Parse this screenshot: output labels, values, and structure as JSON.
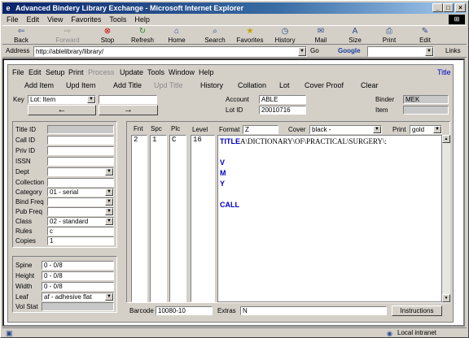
{
  "window": {
    "title": "Advanced Bindery Library Exchange - Microsoft Internet Explorer"
  },
  "ie_menu": [
    "File",
    "Edit",
    "View",
    "Favorites",
    "Tools",
    "Help"
  ],
  "toolbar": {
    "back": "Back",
    "forward": "Forward",
    "stop": "Stop",
    "refresh": "Refresh",
    "home": "Home",
    "search": "Search",
    "favorites": "Favorites",
    "history": "History",
    "mail": "Mail",
    "size": "Size",
    "print": "Print",
    "edit": "Edit"
  },
  "address": {
    "label": "Address",
    "url": "http://ablelibrary/library/",
    "go": "Go",
    "google": "Google",
    "links": "Links"
  },
  "app_menu": {
    "items": [
      "File",
      "Edit",
      "Setup",
      "Print",
      "Process",
      "Update",
      "Tools",
      "Window",
      "Help"
    ],
    "title_link": "Title"
  },
  "app_buttons": {
    "add_item": "Add Item",
    "upd_item": "Upd Item",
    "add_title": "Add Title",
    "upd_title": "Upd Title",
    "history": "History",
    "collation": "Collation",
    "lot": "Lot",
    "cover_proof": "Cover Proof",
    "clear": "Clear"
  },
  "key": {
    "label": "Key",
    "value": "Lot: Item",
    "prev": "←",
    "next": "→"
  },
  "account": {
    "label": "Account",
    "value": "ABLE"
  },
  "lot_id": {
    "label": "Lot ID",
    "value": "20010716"
  },
  "binder": {
    "label": "Binder",
    "value": "MEK"
  },
  "item": {
    "label": "Item",
    "value": ""
  },
  "left_fields": {
    "title_id": "Title ID",
    "call_id": "Call ID",
    "priv_id": "Priv ID",
    "issn": "ISSN",
    "dept": "Dept",
    "collection": "Collection",
    "category": "Category",
    "category_value": "01 - serial",
    "bind_freq": "Bind Freq",
    "pub_freq": "Pub Freq",
    "class": "Class",
    "class_value": "02 - standard",
    "rules": "Rules",
    "rules_value": "c",
    "copies": "Copies",
    "copies_value": "1"
  },
  "spine_fields": {
    "spine": "Spine",
    "spine_value": "0 - 0/8",
    "height": "Height",
    "height_value": "0 - 0/8",
    "width": "Width",
    "width_value": "0 - 0/8",
    "leaf": "Leaf",
    "leaf_value": "af - adhesive flat",
    "vol_stat": "Vol Stat"
  },
  "grid": {
    "fnt_label": "Fnt",
    "spc_label": "Spc",
    "plc_label": "Plc",
    "level_label": "Level",
    "fnt": "2",
    "spc": "1",
    "plc": "C",
    "level": "16",
    "format_label": "Format",
    "format_value": "Z",
    "cover_label": "Cover",
    "cover_value": "black -",
    "print_label": "Print",
    "print_value": "gold"
  },
  "spine_text": {
    "title_kw": "TITLE",
    "title_text": "A\\DICTIONARY\\OF\\PRACTICAL\\SURGERY\\:",
    "v": "V",
    "m": "M",
    "y": "Y",
    "call": "CALL"
  },
  "bottom": {
    "barcode_label": "Barcode",
    "barcode_value": "10080-10",
    "extras_label": "Extras",
    "extras_value": "N",
    "instructions": "Instructions"
  },
  "status": {
    "zone": "Local intranet"
  }
}
